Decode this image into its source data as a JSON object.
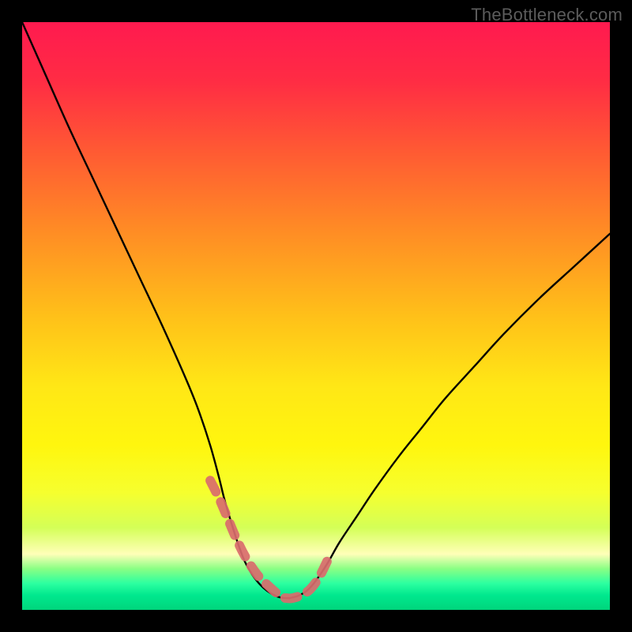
{
  "watermark": "TheBottleneck.com",
  "chart_data": {
    "type": "line",
    "title": "",
    "xlabel": "",
    "ylabel": "",
    "xlim": [
      0,
      100
    ],
    "ylim": [
      0,
      100
    ],
    "series": [
      {
        "name": "left-curve",
        "x": [
          0,
          4,
          8,
          12,
          16,
          20,
          24,
          28,
          30,
          32,
          33.5,
          34.5,
          36,
          37,
          38,
          39.5,
          41,
          42.5,
          44,
          45.5
        ],
        "y": [
          100,
          91,
          82,
          73.5,
          65,
          56.5,
          48,
          39,
          34,
          28,
          22.5,
          18.5,
          13.5,
          10.5,
          8,
          5.5,
          3.8,
          2.7,
          2.1,
          2.0
        ]
      },
      {
        "name": "right-curve",
        "x": [
          45.5,
          47,
          48.5,
          50,
          52,
          54,
          57,
          60,
          64,
          68,
          72,
          77,
          82,
          88,
          94,
          100
        ],
        "y": [
          2.0,
          2.4,
          3.3,
          5.0,
          8.0,
          11.5,
          16.0,
          20.5,
          26.0,
          31.0,
          36.0,
          41.5,
          47.0,
          53.0,
          58.5,
          64.0
        ]
      },
      {
        "name": "dashed-overlay",
        "x": [
          32,
          33.5,
          35,
          36.5,
          38,
          40,
          42,
          44,
          45,
          46,
          47.5,
          49,
          50.5,
          52
        ],
        "y": [
          22,
          19,
          15.5,
          12,
          9,
          6,
          4,
          2.3,
          2.0,
          2.0,
          2.5,
          3.5,
          5.5,
          8.5
        ]
      }
    ],
    "background_gradient": {
      "stops": [
        {
          "offset": 0.0,
          "color": "#ff1a4f"
        },
        {
          "offset": 0.1,
          "color": "#ff2c44"
        },
        {
          "offset": 0.22,
          "color": "#ff5a33"
        },
        {
          "offset": 0.35,
          "color": "#ff8a25"
        },
        {
          "offset": 0.5,
          "color": "#ffc019"
        },
        {
          "offset": 0.62,
          "color": "#ffe716"
        },
        {
          "offset": 0.72,
          "color": "#fff60e"
        },
        {
          "offset": 0.8,
          "color": "#f6ff2e"
        },
        {
          "offset": 0.86,
          "color": "#d4ff57"
        },
        {
          "offset": 0.905,
          "color": "#ffffb8"
        },
        {
          "offset": 0.93,
          "color": "#8aff84"
        },
        {
          "offset": 0.955,
          "color": "#2cffa0"
        },
        {
          "offset": 0.975,
          "color": "#00e88e"
        },
        {
          "offset": 1.0,
          "color": "#00d57c"
        }
      ]
    },
    "dash_color": "#d96b6d",
    "line_color": "#000000"
  }
}
